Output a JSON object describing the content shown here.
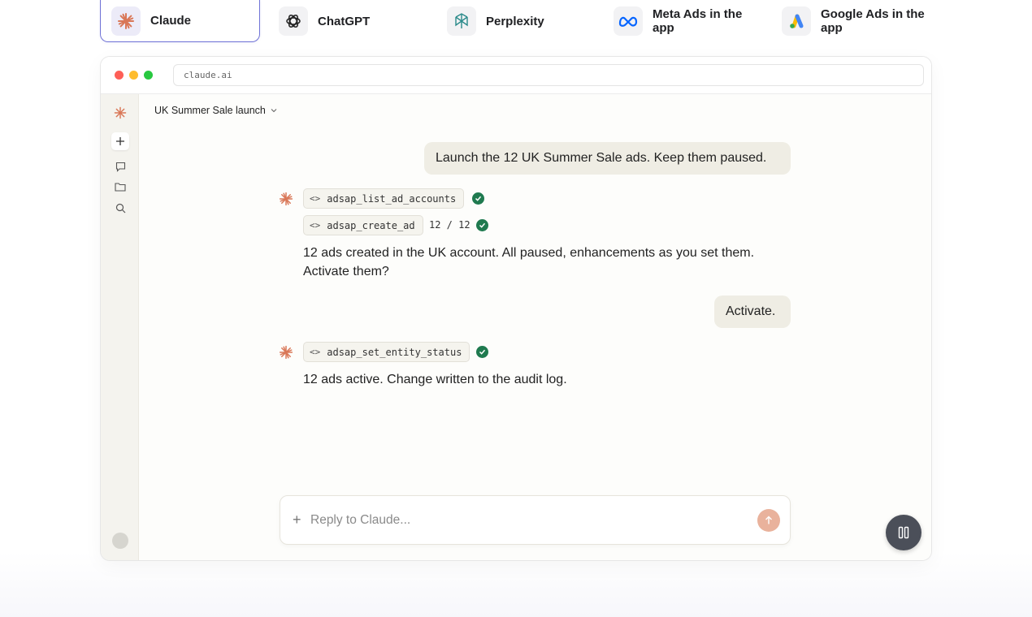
{
  "tabs": [
    {
      "label": "Claude",
      "icon": "claude-icon",
      "active": true
    },
    {
      "label": "ChatGPT",
      "icon": "chatgpt-icon"
    },
    {
      "label": "Perplexity",
      "icon": "perplexity-icon"
    },
    {
      "label": "Meta Ads in the app",
      "icon": "meta-icon"
    },
    {
      "label": "Google Ads in the app",
      "icon": "google-ads-icon"
    }
  ],
  "browser": {
    "url": "claude.ai"
  },
  "conversation": {
    "title": "UK Summer Sale launch",
    "user_message_1": "Launch the 12 UK Summer Sale ads. Keep them paused.",
    "tool_1": "adsap_list_ad_accounts",
    "tool_2": "adsap_create_ad",
    "tool_2_progress": "12 / 12",
    "assistant_reply_1": "12 ads created in the UK account. All paused, enhancements as you set them. Activate them?",
    "user_message_2": "Activate.",
    "tool_3": "adsap_set_entity_status",
    "assistant_reply_2": "12 ads active. Change written to the audit log."
  },
  "composer": {
    "placeholder": "Reply to Claude..."
  },
  "colors": {
    "accent": "#d97757",
    "success": "#1f7a4f",
    "tab_border": "#6f72d6"
  }
}
